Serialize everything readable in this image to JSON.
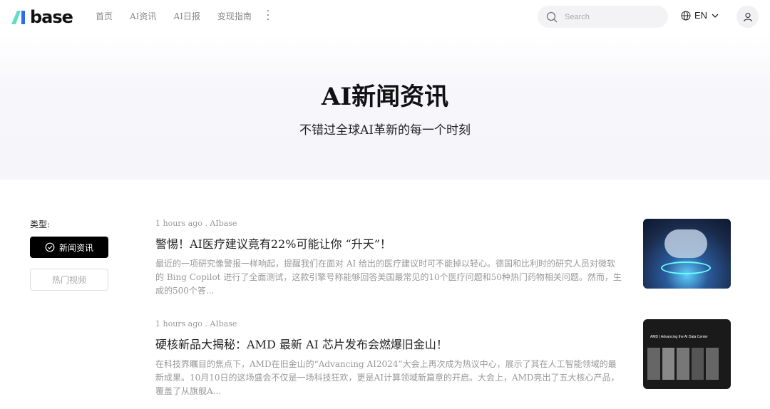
{
  "brand": {
    "logo_text": "base"
  },
  "nav": {
    "items": [
      "首页",
      "AI资讯",
      "AI日报",
      "变现指南"
    ]
  },
  "search": {
    "placeholder": "Search"
  },
  "lang": {
    "label": "EN"
  },
  "hero": {
    "title": "AI新闻资讯",
    "subtitle": "不错过全球AI革新的每一个时刻"
  },
  "filters": {
    "label": "类型:",
    "options": [
      "新闻资讯",
      "热门视频"
    ]
  },
  "articles": [
    {
      "meta": "1 hours ago . AIbase",
      "title": "警惕！AI医疗建议竟有22%可能让你 “升天”！",
      "desc": "最近的一项研究像警报一样响起，提醒我们在面对 AI 给出的医疗建议时可不能掉以轻心。德国和比利时的研究人员对微软的 Bing Copilot 进行了全面测试，这款引擎号称能够回答美国最常见的10个医疗问题和50种热门药物相关问题。然而，生成的500个答..."
    },
    {
      "meta": "1 hours ago . AIbase",
      "title": "硬核新品大揭秘：AMD 最新 AI 芯片发布会燃爆旧金山！",
      "desc": "在科技界瞩目的焦点下，AMD在旧金山的“Advancing AI2024”大会上再次成为热议中心，展示了其在人工智能领域的最新成果。10月10日的这场盛会不仅是一场科技狂欢，更是AI计算领域新篇章的开启。大会上，AMD亮出了五大核心产品，覆盖了从旗舰A...",
      "image_text": "AMD | Advancing the AI Data Center"
    }
  ]
}
